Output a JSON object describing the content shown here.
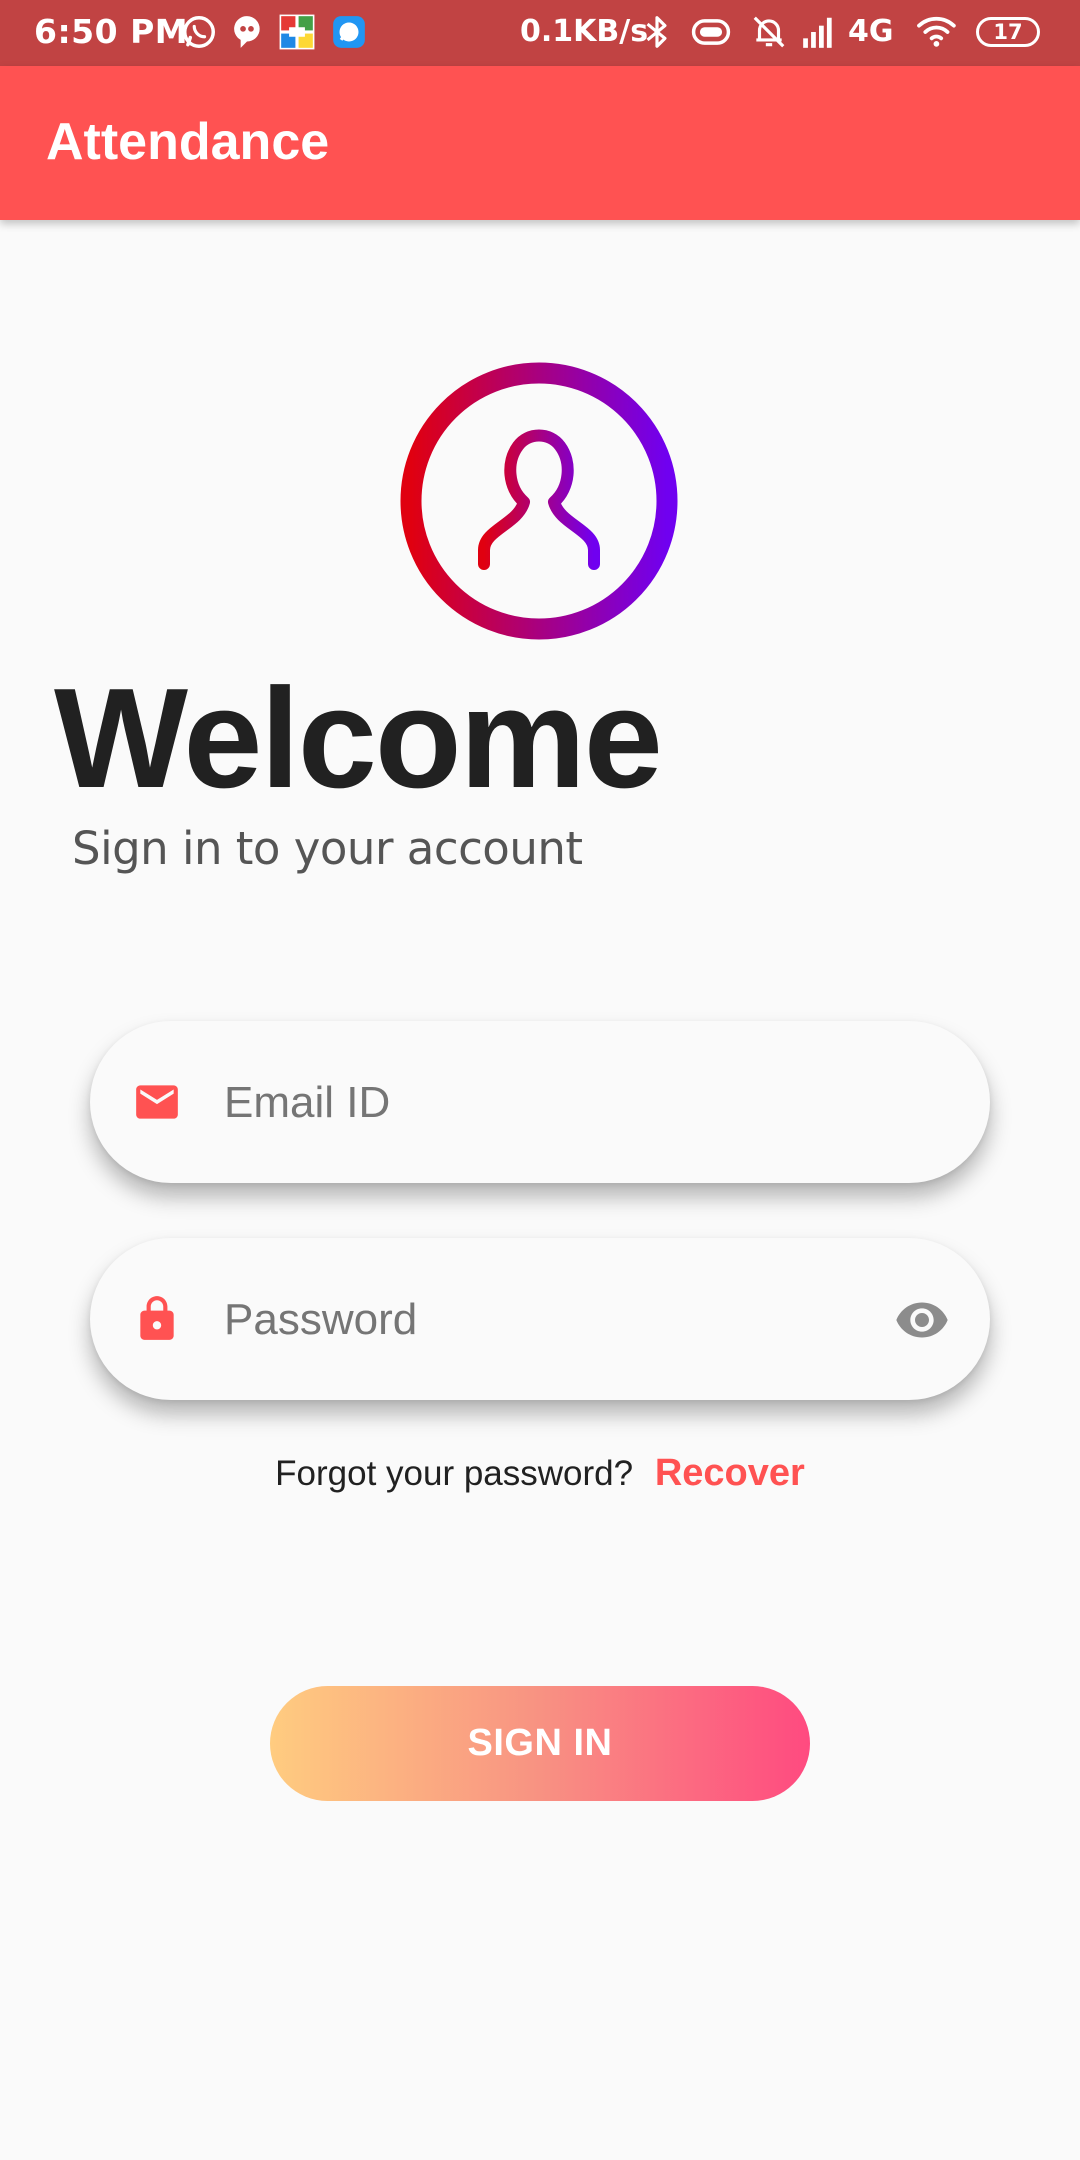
{
  "status_bar": {
    "time": "6:50 PM",
    "network_speed": "0.1KB/s",
    "network_type": "4G",
    "battery": "17",
    "icons": [
      "whatsapp-icon",
      "hike-icon",
      "ludo-app-icon",
      "messages-app-icon",
      "bluetooth-icon",
      "vibrate-icon",
      "mute-bell-icon",
      "signal-icon",
      "wifi-icon",
      "battery-icon"
    ]
  },
  "app_bar": {
    "title": "Attendance",
    "color": "#ff5252"
  },
  "welcome": {
    "title": "Welcome",
    "subtitle": "Sign in to your account",
    "logo_icon": "user-circle-icon",
    "logo_gradient": [
      "#e00010",
      "#7000f0"
    ]
  },
  "form": {
    "email": {
      "placeholder": "Email ID",
      "value": "",
      "icon": "mail-icon"
    },
    "password": {
      "placeholder": "Password",
      "value": "",
      "icon": "lock-icon",
      "toggle_icon": "eye-icon"
    },
    "forgot_text": "Forgot your password?",
    "recover_label": "Recover",
    "accent": "#ff5252"
  },
  "signin": {
    "label": "SIGN IN",
    "gradient": [
      "#ffcc80",
      "#ff4a80"
    ]
  }
}
